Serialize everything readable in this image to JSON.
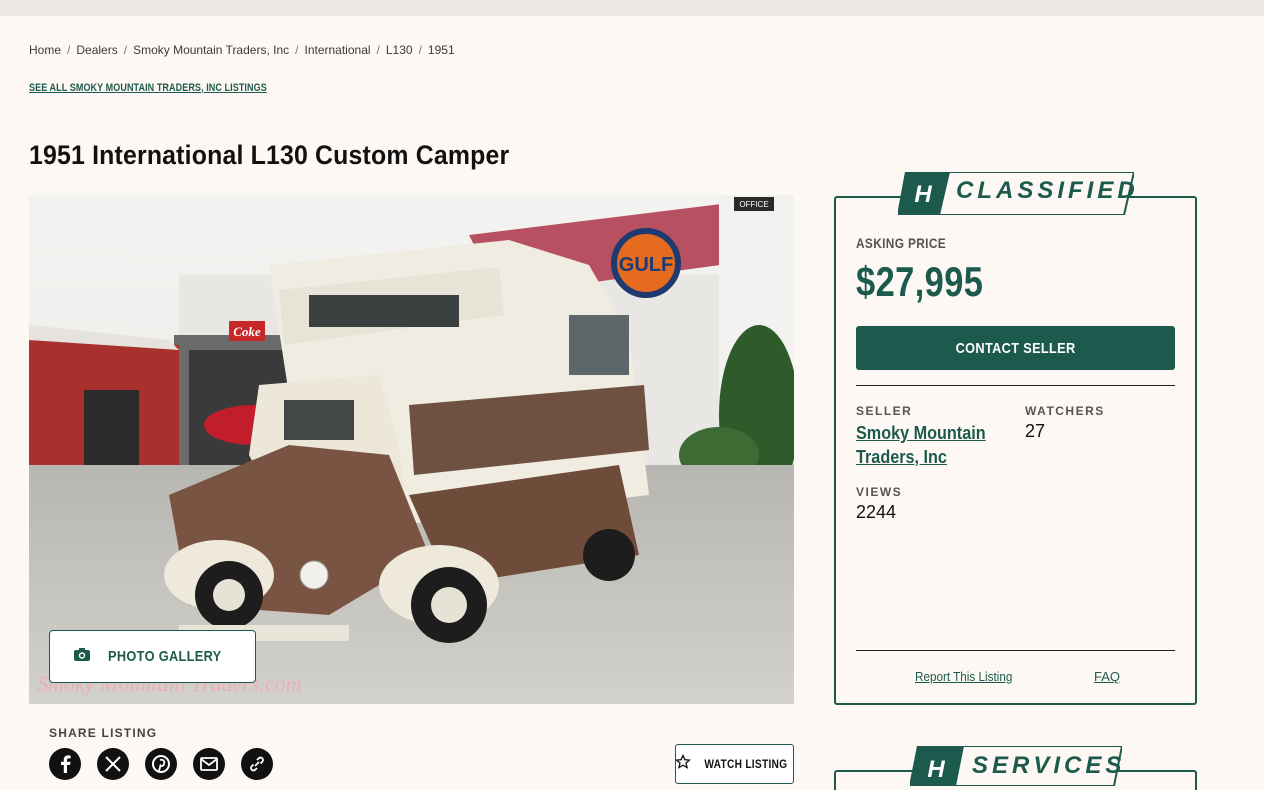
{
  "breadcrumb": [
    "Home",
    "Dealers",
    "Smoky Mountain Traders, Inc",
    "International",
    "L130",
    "1951"
  ],
  "see_all": "SEE ALL SMOKY MOUNTAIN TRADERS, INC LISTINGS",
  "title": "1951 International L130 Custom Camper",
  "photo": {
    "gallery_label": "PHOTO GALLERY",
    "sign_coke": "Coke",
    "sign_gulf": "GULF",
    "sign_office": "OFFICE"
  },
  "share": {
    "label": "SHARE LISTING",
    "icons": [
      "facebook-icon",
      "x-icon",
      "pinterest-icon",
      "email-icon",
      "link-icon"
    ]
  },
  "watch_label": "WATCH LISTING",
  "classified": {
    "banner": "CLASSIFIED",
    "asking_label": "ASKING PRICE",
    "price": "$27,995",
    "contact_label": "CONTACT SELLER",
    "seller_label": "SELLER",
    "seller_name": "Smoky Mountain Traders, Inc",
    "watchers_label": "WATCHERS",
    "watchers": "27",
    "views_label": "VIEWS",
    "views": "2244",
    "report_label": "Report This Listing",
    "faq_label": "FAQ"
  },
  "services_banner": "SERVICES",
  "colors": {
    "brand": "#1d5a4e",
    "background": "#fdf8f3"
  }
}
